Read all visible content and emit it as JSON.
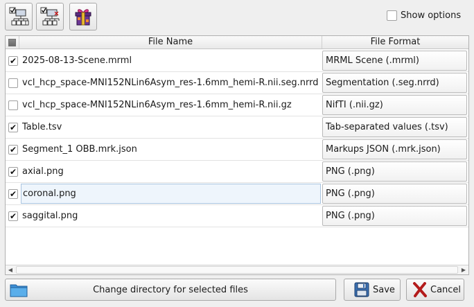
{
  "toolbar": {
    "show_options_label": "Show options",
    "show_options_checked": false
  },
  "table": {
    "headers": {
      "name": "File Name",
      "format": "File Format"
    },
    "rows": [
      {
        "checked": true,
        "name": "2025-08-13-Scene.mrml",
        "format": "MRML Scene (.mrml)"
      },
      {
        "checked": false,
        "name": "vcl_hcp_space-MNI152NLin6Asym_res-1.6mm_hemi-R.nii.seg.nrrd",
        "format": "Segmentation (.seg.nrrd)"
      },
      {
        "checked": false,
        "name": "vcl_hcp_space-MNI152NLin6Asym_res-1.6mm_hemi-R.nii.gz",
        "format": "NifTI (.nii.gz)"
      },
      {
        "checked": true,
        "name": "Table.tsv",
        "format": "Tab-separated values (.tsv)"
      },
      {
        "checked": true,
        "name": "Segment_1 OBB.mrk.json",
        "format": "Markups JSON (.mrk.json)"
      },
      {
        "checked": true,
        "name": "axial.png",
        "format": "PNG (.png)"
      },
      {
        "checked": true,
        "name": "coronal.png",
        "format": "PNG (.png)",
        "editing": true
      },
      {
        "checked": true,
        "name": "saggital.png",
        "format": "PNG (.png)"
      }
    ]
  },
  "buttons": {
    "change_dir_label": "Change directory for selected files",
    "save_label": "Save",
    "cancel_label": "Cancel"
  }
}
